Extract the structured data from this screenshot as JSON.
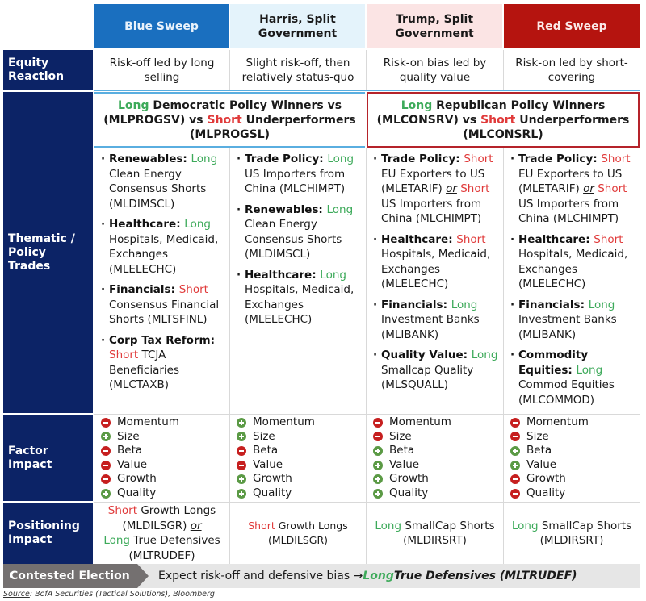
{
  "columns": [
    {
      "key": "blue",
      "title": "Blue Sweep",
      "color": "#1a6fbf"
    },
    {
      "key": "harris",
      "title": "Harris, Split Government",
      "color": "#e4f3fb"
    },
    {
      "key": "trump",
      "title": "Trump, Split Government",
      "color": "#fbe4e4"
    },
    {
      "key": "red",
      "title": "Red Sweep",
      "color": "#b5140f"
    }
  ],
  "row_labels": {
    "equity": "Equity Reaction",
    "thematic": "Thematic / Policy Trades",
    "factor": "Factor Impact",
    "positioning": "Positioning Impact"
  },
  "equity_reaction": {
    "blue": "Risk-off led by long selling",
    "harris": "Slight risk-off, then relatively status-quo",
    "trump": "Risk-on bias led by quality value",
    "red": "Risk-on led by short-covering"
  },
  "policy_banners": {
    "dem": {
      "long": "Long",
      "part1": " Democratic Policy Winners vs (MLPROGSV) vs ",
      "short": "Short",
      "part2": " Underperformers (MLPROGSL)"
    },
    "rep": {
      "long": "Long",
      "part1": " Republican Policy Winners (MLCONSRV) vs ",
      "short": "Short",
      "part2": " Underperformers (MLCONSRL)"
    }
  },
  "thematic": {
    "blue": [
      {
        "topic": "Renewables",
        "dir": "Long",
        "text": "Clean Energy Consensus Shorts (MLDIMSCL)"
      },
      {
        "topic": "Healthcare",
        "dir": "Long",
        "text": "Hospitals, Medicaid, Exchanges (MLELECHC)"
      },
      {
        "topic": "Financials",
        "dir": "Short",
        "text": "Consensus Financial Shorts (MLTSFINL)"
      },
      {
        "topic": "Corp Tax Reform",
        "dir": "Short",
        "text": "TCJA Beneficiaries (MLCTAXB)"
      }
    ],
    "harris": [
      {
        "topic": "Trade Policy",
        "dir": "Long",
        "text": "US Importers from China (MLCHIMPT)"
      },
      {
        "topic": "Renewables",
        "dir": "Long",
        "text": "Clean Energy Consensus Shorts (MLDIMSCL)"
      },
      {
        "topic": "Healthcare",
        "dir": "Long",
        "text": "Hospitals, Medicaid, Exchanges (MLELECHC)"
      }
    ],
    "trump": [
      {
        "topic": "Trade Policy",
        "dir": "Short",
        "text": "EU Exporters to US (MLETARIF)",
        "or": "or",
        "dir2": "Short",
        "text2": "US Importers from China (MLCHIMPT)"
      },
      {
        "topic": "Healthcare",
        "dir": "Short",
        "text": "Hospitals, Medicaid, Exchanges (MLELECHC)"
      },
      {
        "topic": "Financials",
        "dir": "Long",
        "text": "Investment Banks (MLIBANK)"
      },
      {
        "topic": "Quality Value",
        "dir": "Long",
        "text": "Smallcap Quality (MLSQUALL)"
      }
    ],
    "red": [
      {
        "topic": "Trade Policy",
        "dir": "Short",
        "text": "EU Exporters to US (MLETARIF)",
        "or": "or",
        "dir2": "Short",
        "text2": "US Importers from China (MLCHIMPT)"
      },
      {
        "topic": "Healthcare",
        "dir": "Short",
        "text": "Hospitals, Medicaid, Exchanges (MLELECHC)"
      },
      {
        "topic": "Financials",
        "dir": "Long",
        "text": "Investment Banks (MLIBANK)"
      },
      {
        "topic": "Commodity Equities",
        "dir": "Long",
        "text": "Commod Equities (MLCOMMOD)"
      }
    ]
  },
  "factor_impact": {
    "blue": [
      {
        "name": "Momentum",
        "sign": "minus"
      },
      {
        "name": "Size",
        "sign": "plus"
      },
      {
        "name": "Beta",
        "sign": "minus"
      },
      {
        "name": "Value",
        "sign": "minus"
      },
      {
        "name": "Growth",
        "sign": "minus"
      },
      {
        "name": "Quality",
        "sign": "plus"
      }
    ],
    "harris": [
      {
        "name": "Momentum",
        "sign": "plus"
      },
      {
        "name": "Size",
        "sign": "plus"
      },
      {
        "name": "Beta",
        "sign": "minus"
      },
      {
        "name": "Value",
        "sign": "minus"
      },
      {
        "name": "Growth",
        "sign": "plus"
      },
      {
        "name": "Quality",
        "sign": "plus"
      }
    ],
    "trump": [
      {
        "name": "Momentum",
        "sign": "minus"
      },
      {
        "name": "Size",
        "sign": "minus"
      },
      {
        "name": "Beta",
        "sign": "plus"
      },
      {
        "name": "Value",
        "sign": "plus"
      },
      {
        "name": "Growth",
        "sign": "plus"
      },
      {
        "name": "Quality",
        "sign": "plus"
      }
    ],
    "red": [
      {
        "name": "Momentum",
        "sign": "minus"
      },
      {
        "name": "Size",
        "sign": "minus"
      },
      {
        "name": "Beta",
        "sign": "plus"
      },
      {
        "name": "Value",
        "sign": "plus"
      },
      {
        "name": "Growth",
        "sign": "minus"
      },
      {
        "name": "Quality",
        "sign": "minus"
      }
    ]
  },
  "positioning": {
    "blue": {
      "dir": "Short",
      "text": " Growth Longs (MLDILSGR) ",
      "or": "or",
      "dir2": "Long",
      "text2": " True Defensives (MLTRUDEF)"
    },
    "harris": {
      "dir": "Short",
      "text": " Growth Longs (MLDILSGR)"
    },
    "trump": {
      "dir": "Long",
      "text": " SmallCap Shorts (MLDIRSRT)"
    },
    "red": {
      "dir": "Long",
      "text": " SmallCap Shorts (MLDIRSRT)"
    }
  },
  "contested": {
    "label": "Contested Election",
    "text": "Expect risk-off and defensive bias → ",
    "long": "Long",
    "rest": " True Defensives (MLTRUDEF)"
  },
  "source": {
    "label": "Source",
    "text": ": BofA Securities (Tactical Solutions), Bloomberg"
  }
}
